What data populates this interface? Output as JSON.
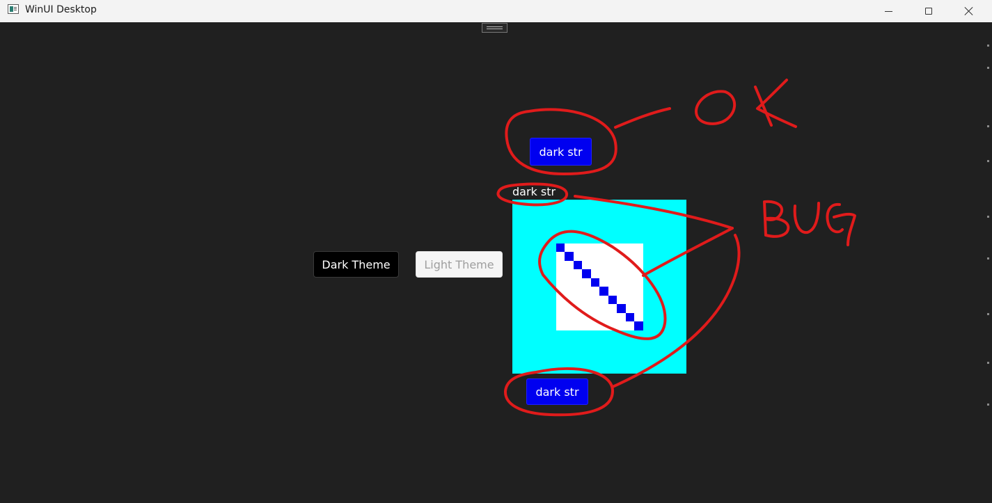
{
  "window": {
    "title": "WinUI Desktop",
    "controls": {
      "minimize_icon": "minimize-icon",
      "maximize_icon": "maximize-icon",
      "close_icon": "close-icon"
    }
  },
  "theme_buttons": {
    "dark_label": "Dark Theme",
    "light_label": "Light Theme"
  },
  "content": {
    "top_button_label": "dark str",
    "caption_label": "dark str",
    "bottom_button_label": "dark str"
  },
  "annotations": {
    "ok_label": "OK",
    "bug_label": "BUG"
  },
  "colors": {
    "window_background": "#202020",
    "accent_blue": "#0000f0",
    "cyan": "#00ffff",
    "annotation_red": "#e01b1b"
  }
}
